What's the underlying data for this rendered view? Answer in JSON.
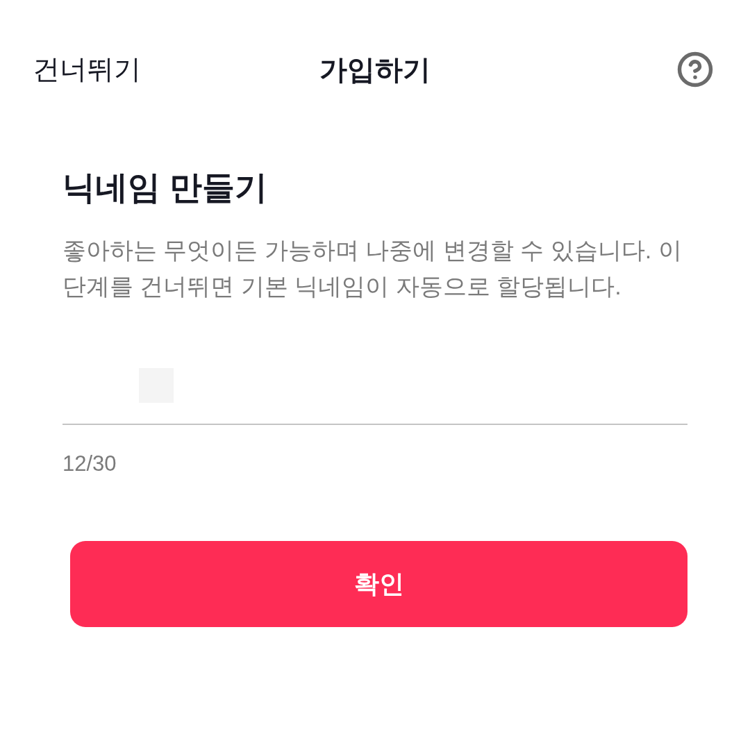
{
  "header": {
    "skip": "건너뛰기",
    "title": "가입하기"
  },
  "heading": "닉네임 만들기",
  "description": "좋아하는 무엇이든 가능하며 나중에 변경할 수 있습니다. 이 단계를 건너뛰면 기본 닉네임이 자동으로 할당됩니다.",
  "nickname_field": {
    "counter": "12/30"
  },
  "confirm_button": "확인"
}
